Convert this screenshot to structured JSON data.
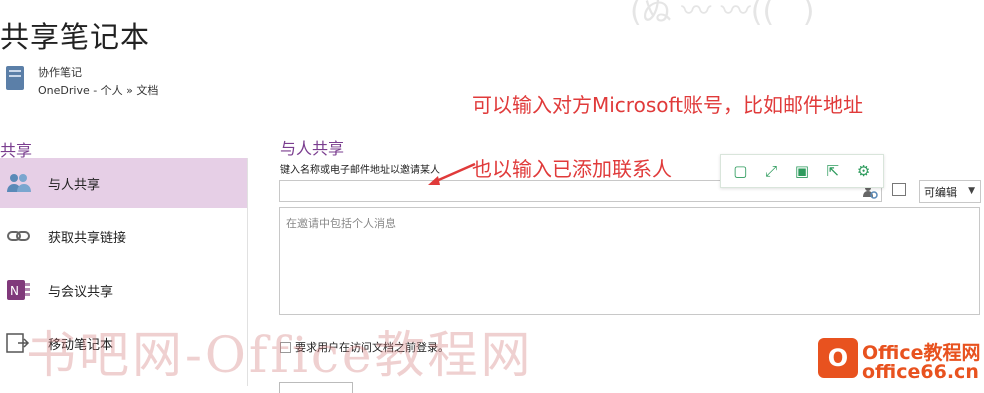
{
  "page": {
    "title": "共享笔记本"
  },
  "notebook": {
    "name": "协作笔记",
    "location": "OneDrive - 个人 » 文档"
  },
  "sidebar": {
    "heading": "共享",
    "items": [
      {
        "label": "与人共享",
        "icon": "people-icon",
        "active": true
      },
      {
        "label": "获取共享链接",
        "icon": "link-icon",
        "active": false
      },
      {
        "label": "与会议共享",
        "icon": "onenote-icon",
        "active": false
      },
      {
        "label": "移动笔记本",
        "icon": "move-notebook-icon",
        "active": false
      }
    ]
  },
  "share": {
    "heading": "与人共享",
    "invite_label": "键入名称或电子邮件地址以邀请某人",
    "invite_value": "",
    "permission": "可编辑",
    "message_placeholder": "在邀请中包括个人消息",
    "require_signin_label": "要求用户在访问文档之前登录。",
    "require_signin_checked": false
  },
  "annotations": {
    "line1": "可以输入对方Microsoft账号，比如邮件地址",
    "line2": "也以输入已添加联系人"
  },
  "floating_toolbar": [
    "copy-icon",
    "expand-icon",
    "save-icon",
    "share-icon",
    "settings-icon"
  ],
  "watermark": {
    "text": "书吧网-Office教程网"
  },
  "logo": {
    "mark": "O",
    "line1": "Office教程网",
    "line2": "office66.cn"
  },
  "colors": {
    "accent": "#7a3d8f",
    "active_bg": "#e6cfe6",
    "annotation": "#e03a3a",
    "toolbar_icon": "#2e9b5d",
    "logo": "#e8521f"
  }
}
